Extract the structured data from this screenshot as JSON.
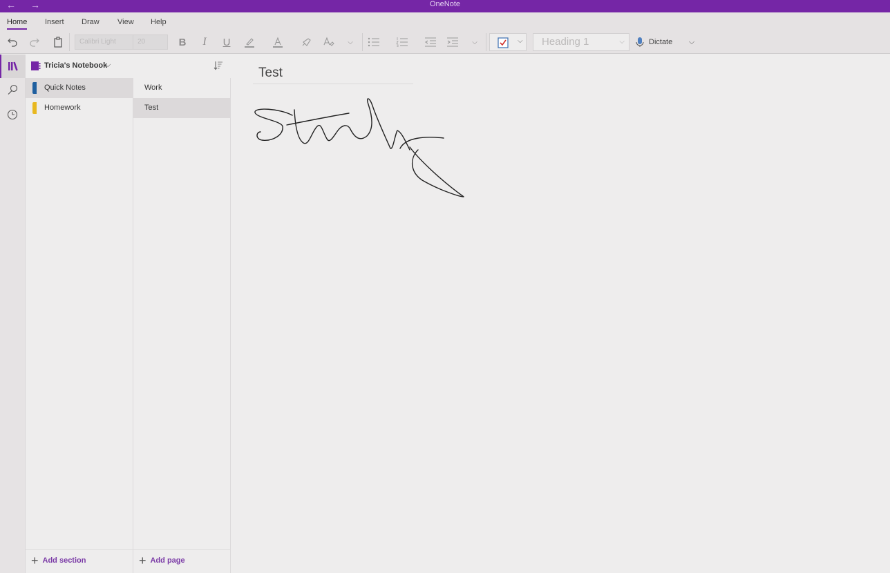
{
  "titlebar": {
    "title": "OneNote",
    "back_icon": "←",
    "forward_icon": "→"
  },
  "ribbon": {
    "tabs": [
      {
        "label": "Home",
        "active": true
      },
      {
        "label": "Insert",
        "active": false
      },
      {
        "label": "Draw",
        "active": false
      },
      {
        "label": "View",
        "active": false
      },
      {
        "label": "Help",
        "active": false
      }
    ],
    "font_name": "Calibri Light",
    "font_size": "20",
    "style": "Heading 1",
    "dictate_label": "Dictate",
    "accent_color": "#7526a6"
  },
  "notebook": {
    "name": "Tricia's Notebook",
    "sections": [
      {
        "label": "Quick Notes",
        "color": "#1f5f9f",
        "selected": true
      },
      {
        "label": "Homework",
        "color": "#e8b820",
        "selected": false
      }
    ],
    "pages": [
      {
        "label": "Work",
        "selected": false
      },
      {
        "label": "Test",
        "selected": true
      }
    ],
    "add_section_label": "Add section",
    "add_page_label": "Add page"
  },
  "page": {
    "title": "Test",
    "ink_text": "Study"
  }
}
